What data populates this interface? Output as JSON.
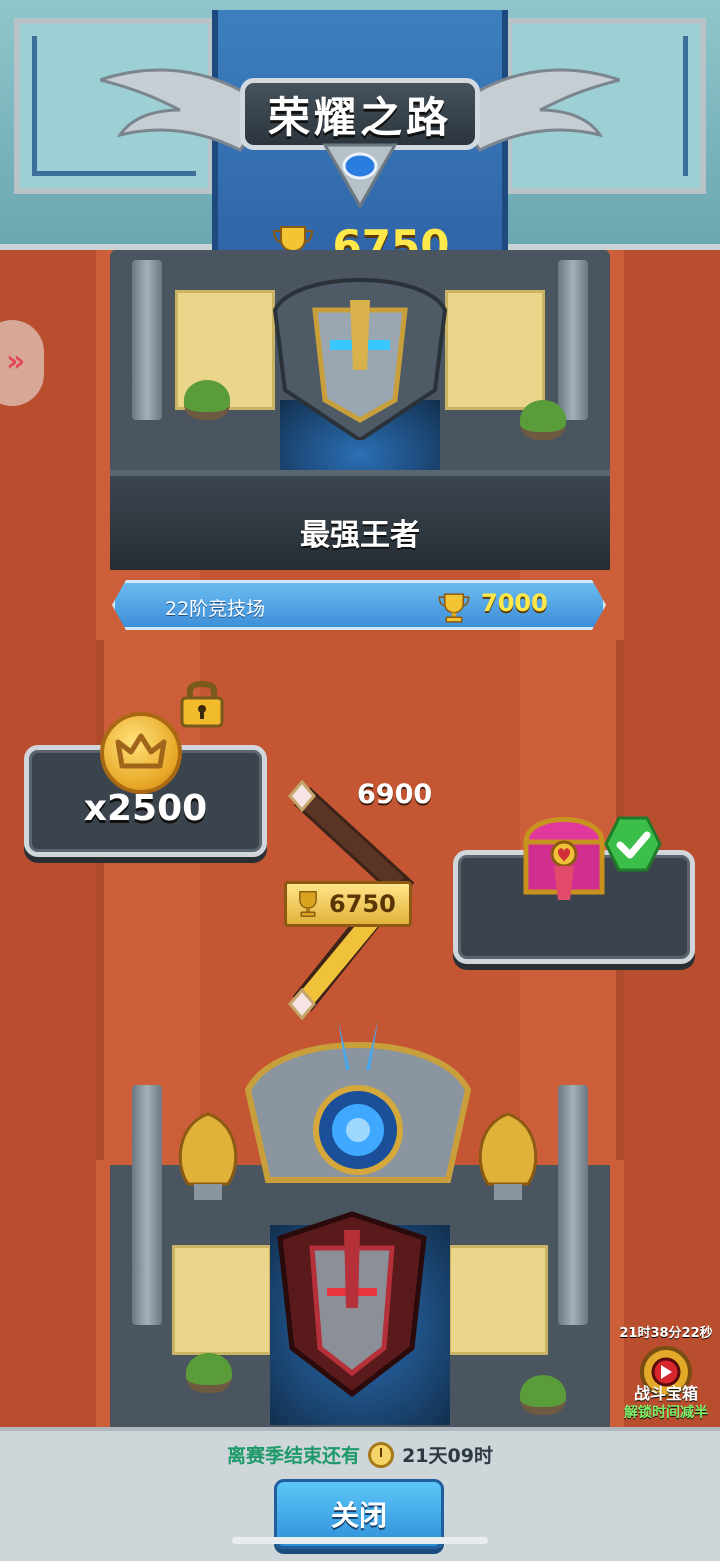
{
  "header": {
    "title": "荣耀之路",
    "trophies": "6750"
  },
  "current_arena": {
    "rank_name": "最强王者",
    "arena_label": "22阶竞技场",
    "arena_trophies": "7000"
  },
  "road": {
    "milestone_value": "6900",
    "current_value": "6750",
    "coin_reward": "x2500",
    "coin_reward_locked": true,
    "chest_reward_claimed": true
  },
  "battle_chest": {
    "timer": "21时38分22秒",
    "name": "战斗宝箱",
    "note": "解锁时间减半"
  },
  "footer": {
    "season_label": "离赛季结束还有",
    "season_time": "21天09时",
    "close_label": "关闭"
  },
  "colors": {
    "trophy_text": "#ffe84a",
    "season_label": "#1e9a6a",
    "chest_note": "#7df06a",
    "close_button": "#3aa6e8"
  },
  "icons": [
    "trophy-icon",
    "lock-icon",
    "coin-icon",
    "chest-icon",
    "check-icon",
    "clock-icon",
    "side-tab-chevron-icon",
    "battle-chest-icon"
  ]
}
